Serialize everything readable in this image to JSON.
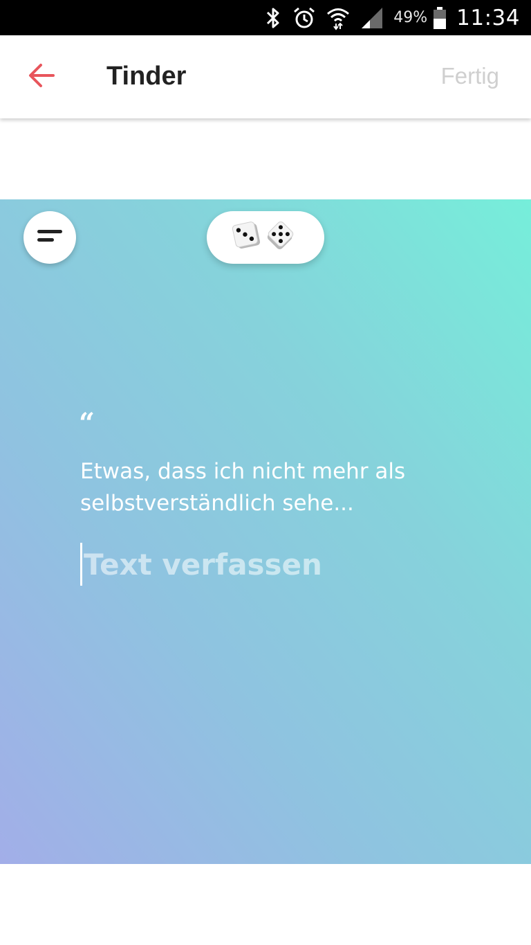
{
  "status_bar": {
    "battery_percent": "49%",
    "time": "11:34",
    "icons": [
      "bluetooth-icon",
      "alarm-icon",
      "wifi-icon",
      "signal-icon",
      "battery-icon"
    ]
  },
  "header": {
    "back_icon": "arrow-left-icon",
    "title": "Tinder",
    "done_label": "Fertig",
    "accent_color": "#e8555c",
    "done_color": "#cfcfcf"
  },
  "prompt_card": {
    "menu_icon": "menu-lines-icon",
    "dice_icon": "dice-icon",
    "quote_mark": "“",
    "prompt_text": "Etwas, dass ich nicht mehr als selbstverständlich sehe...",
    "input_placeholder": "Text verfassen",
    "input_value": "",
    "gradient_colors": [
      "#a2aee8",
      "#8fc3e0",
      "#86d2db",
      "#76eeda"
    ]
  }
}
